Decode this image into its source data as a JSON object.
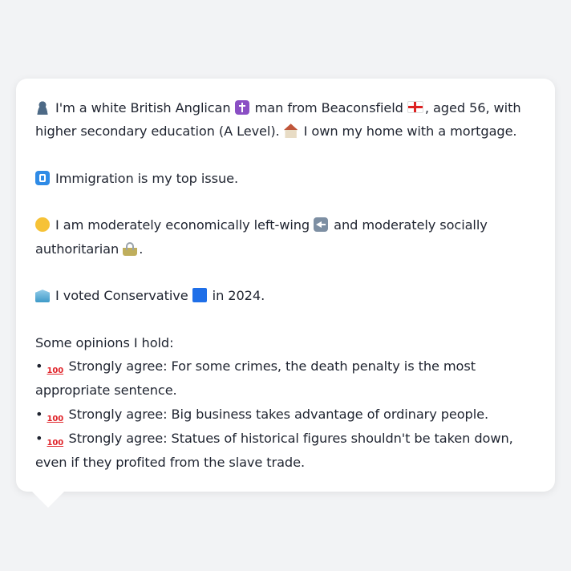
{
  "colors": {
    "background": "#f2f3f5",
    "card": "#ffffff",
    "text": "#1f2430"
  },
  "profile": {
    "line1_a": "I'm a white British Anglican",
    "line1_b": "man from Beaconsfield",
    "line1_c": ", aged 56, with higher secondary education (A Level).",
    "line1_d": "I own my home with a mortgage.",
    "issue": "Immigration is my top issue.",
    "ideology_a": "I am moderately economically left-wing",
    "ideology_b": "and moderately socially authoritarian",
    "ideology_c": ".",
    "vote_a": "I voted Conservative",
    "vote_b": "in 2024.",
    "opinions_heading": "Some opinions I hold:",
    "opinions": [
      {
        "bullet": "•",
        "icon": "hundred-points",
        "text": "Strongly agree: For some crimes, the death penalty is the most appropriate sentence."
      },
      {
        "bullet": "•",
        "icon": "hundred-points",
        "text": "Strongly agree: Big business takes advantage of ordinary people."
      },
      {
        "bullet": "•",
        "icon": "hundred-points",
        "text": "Strongly agree: Statues of historical figures shouldn't be taken down, even if they profited from the slave trade."
      }
    ],
    "icons": {
      "hundred": "100"
    }
  }
}
